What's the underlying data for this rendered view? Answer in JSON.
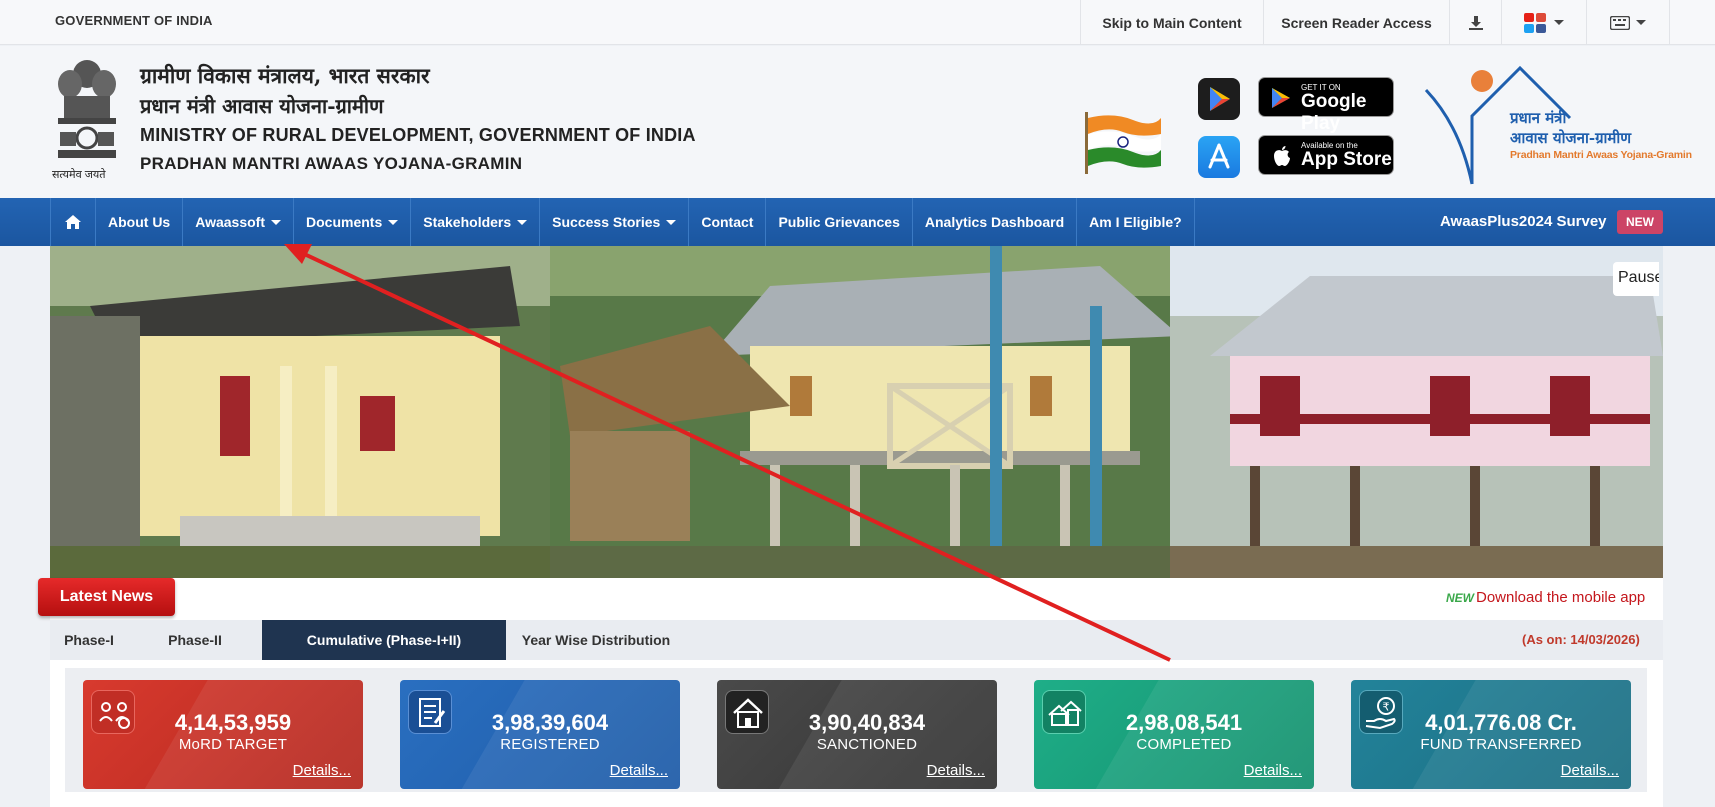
{
  "topbar": {
    "gov_label": "GOVERNMENT OF INDIA",
    "skip_label": "Skip to Main Content",
    "reader_label": "Screen Reader Access",
    "download_icon": "download-icon",
    "social_icon": "social-icon",
    "keyboard_icon": "keyboard-icon"
  },
  "header": {
    "hindi_line1": "ग्रामीण विकास मंत्रालय, भारत सरकार",
    "hindi_line2": "प्रधान मंत्री आवास योजना-ग्रामीण",
    "english_line1": "MINISTRY OF RURAL DEVELOPMENT, GOVERNMENT OF INDIA",
    "english_line2": "PRADHAN MANTRI AWAAS YOJANA-GRAMIN",
    "emblem_caption": "सत्यमेव जयते",
    "google_play_small": "GET IT ON",
    "google_play_big": "Google Play",
    "app_store_small": "Available on the",
    "app_store_big": "App Store",
    "logo_line1": "प्रधान मंत्री",
    "logo_line2": "आवास योजना-ग्रामीण",
    "logo_line3": "Pradhan Mantri Awaas Yojana-Gramin"
  },
  "nav": {
    "home_icon": "home-icon",
    "items": [
      {
        "label": "About Us",
        "dropdown": false
      },
      {
        "label": "Awaassoft",
        "dropdown": true
      },
      {
        "label": "Documents",
        "dropdown": true
      },
      {
        "label": "Stakeholders",
        "dropdown": true
      },
      {
        "label": "Success Stories",
        "dropdown": true
      },
      {
        "label": "Contact",
        "dropdown": false
      },
      {
        "label": "Public Grievances",
        "dropdown": false
      },
      {
        "label": "Analytics Dashboard",
        "dropdown": false
      },
      {
        "label": "Am I Eligible?",
        "dropdown": false
      }
    ],
    "survey_label": "AwaasPlus2024 Survey",
    "new_badge": "NEW"
  },
  "banner": {
    "pause_label": "Pause"
  },
  "news": {
    "title": "Latest News",
    "new_tag": "NEW",
    "ticker_text": "Download the mobile app"
  },
  "tabs": {
    "items": [
      "Phase-I",
      "Phase-II",
      "Cumulative (Phase-I+II)",
      "Year Wise Distribution"
    ],
    "active": "Cumulative (Phase-I+II)",
    "as_on": "(As on: 14/03/2026)"
  },
  "stats": [
    {
      "value": "4,14,53,959",
      "label": "MoRD TARGET",
      "details": "Details...",
      "icon": "target-people-icon",
      "color": "#d83a2e"
    },
    {
      "value": "3,98,39,604",
      "label": "REGISTERED",
      "details": "Details...",
      "icon": "register-document-icon",
      "color": "#2a6fc0"
    },
    {
      "value": "3,90,40,834",
      "label": "SANCTIONED",
      "details": "Details...",
      "icon": "house-icon",
      "color": "#4a4a4a"
    },
    {
      "value": "2,98,08,541",
      "label": "COMPLETED",
      "details": "Details...",
      "icon": "houses-completed-icon",
      "color": "#1fae88"
    },
    {
      "value": "4,01,776.08 Cr.",
      "label": "FUND TRANSFERRED",
      "details": "Details...",
      "icon": "rupee-hand-icon",
      "color": "#23839a"
    }
  ]
}
